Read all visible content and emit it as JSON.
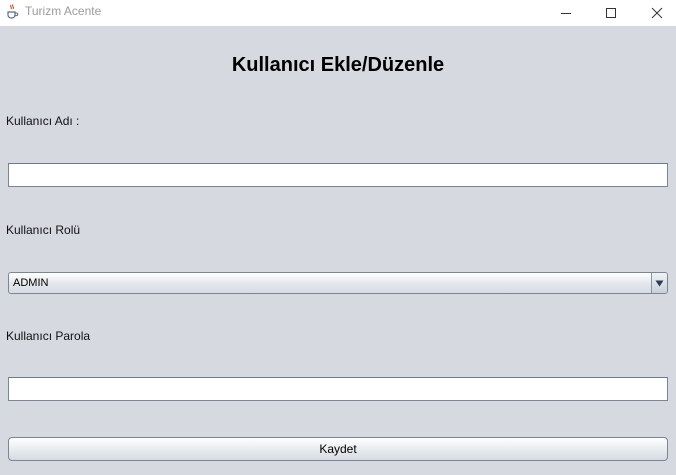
{
  "window": {
    "title": "Turizm Acente"
  },
  "form": {
    "heading": "Kullanıcı Ekle/Düzenle",
    "username_label": "Kullanıcı Adı :",
    "username_value": "",
    "role_label": "Kullanıcı Rolü",
    "role_selected": "ADMIN",
    "password_label": "Kullanıcı Parola",
    "password_value": "",
    "save_label": "Kaydet"
  },
  "icons": {
    "app": "java-cup-icon",
    "minimize": "minimize-icon",
    "maximize": "maximize-icon",
    "close": "close-icon",
    "dropdown": "triangle-down-icon"
  }
}
